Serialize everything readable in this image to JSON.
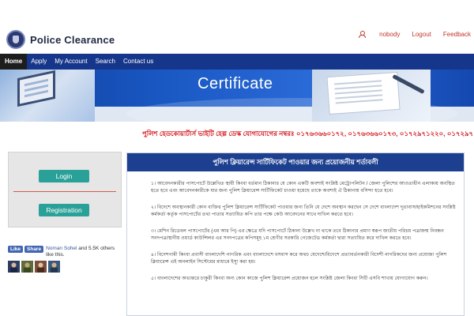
{
  "header": {
    "brand": "Police Clearance",
    "user": "nobody",
    "logout": "Logout",
    "feedback": "Feedback"
  },
  "nav": {
    "items": [
      "Home",
      "Apply",
      "My Account",
      "Search",
      "Contact us"
    ]
  },
  "banner": {
    "title": "Certificate"
  },
  "hotline": "পুলিশ হেডকোয়ার্টার্স ভাইটি হেল্প ডেস্ক যোগাযোগের নম্বরঃ ০১৭৬৩৬৬০১৭২, ০১৭৬৩৬৬০১৭৩, ০১৭২৯৭১২২০, ০১৭২৯৭১২২৩।",
  "auth": {
    "login": "Login",
    "registration": "Registration"
  },
  "facebook": {
    "like": "Like",
    "share": "Share",
    "name": "Noman Sohel",
    "text": " and 5.5K others like this."
  },
  "panel": {
    "title": "পুলিশ ক্লিয়ারেন্স সার্টিফিকেট পাওয়ার জন্য প্রয়োজনীয় শর্তাবলী",
    "paragraphs": [
      "১। আবেদনকারীর পাসপোর্টে উল্লেখিত স্থায়ী কিংবা বর্তমান ঠিকানার যে কোন একটি অবশ্যই সংশ্লিষ্ট মেট্রোপলিটন / জেলা পুলিশের আওতাধীন এলাকায় অবস্থিত হতে হবে এবং আবেদনকারীকে যার জন্য পুলিশ ক্লিয়ারেন্স সার্টিফিকেট চাওয়া হয়েছে তাকে অবশ্যই ঐ ঠিকানায় বসিন্দা হতে হবে।",
      "২। বিদেশে অবস্থানকারী কোন ব্যক্তির পুলিশ ক্লিয়ারেন্স সার্টিফিকেট পাওয়ার জন্য তিনি যে দেশে অবস্থান করছেন সে দেশে বাংলাদেশ দূতাবাস/হাইকমিশনের সংশ্লিষ্ট কর্মকর্তা কর্তৃক পাসপোর্টের তথ্য পাতার সত্যায়িত কপি তার পক্ষে কেউ আবেদনের সাথে দাখিল করতে হবে।",
      "৩। মেশিন রিডেবল পাসপোর্টের (এম আর পি) এর ক্ষেত্রে যদি পাসপোর্টে ঠিকানা উল্লেখ না থাকে তবে ঠিকানার প্রমাণ স্বরূপ জাতীয় পরিচয় পত্র/জন্ম নিবন্ধন সনদপত্র/স্থানীয় ওয়ার্ড কাউন্সিলর এর সনদপত্রের কপিসমূহ ১ম শ্রেণীর সরকারি গেজেটেড কর্মকর্তা দ্বারা সত্যায়িত করে দাখিল করতে হবে।",
      "৪। বিদেশগামী কিংবা প্রবাসী বাংলাদেশি নাগরিক এবং বাংলাদেশে বসবাস করে অথচ যেদেশে/বিদেশে প্রত্যাবর্তনকারী বিদেশী নাগরিকদের জন্য প্রযোজ্য পুলিশ ক্লিয়ারেন্স এই অনলাইন সিস্টেমের মাধ্যমে ইস্যু করা হয়।",
      "৫। বাংলাদেশের অভ্যন্তরে চাকুরী কিংবা অন্য কোন কাজে পুলিশ ক্লিয়ারেন্স প্রয়োজন হলে সংশ্লিষ্ট জেলা কিংবা সিটি এসবি শাখায় যোগাযোগ করুন।"
    ]
  },
  "colors": {
    "nav": "#15368a",
    "nav_active": "#1d1d1d",
    "accent_red": "#d4161c",
    "button": "#2aa198",
    "panel_header": "#1d3f8f"
  }
}
